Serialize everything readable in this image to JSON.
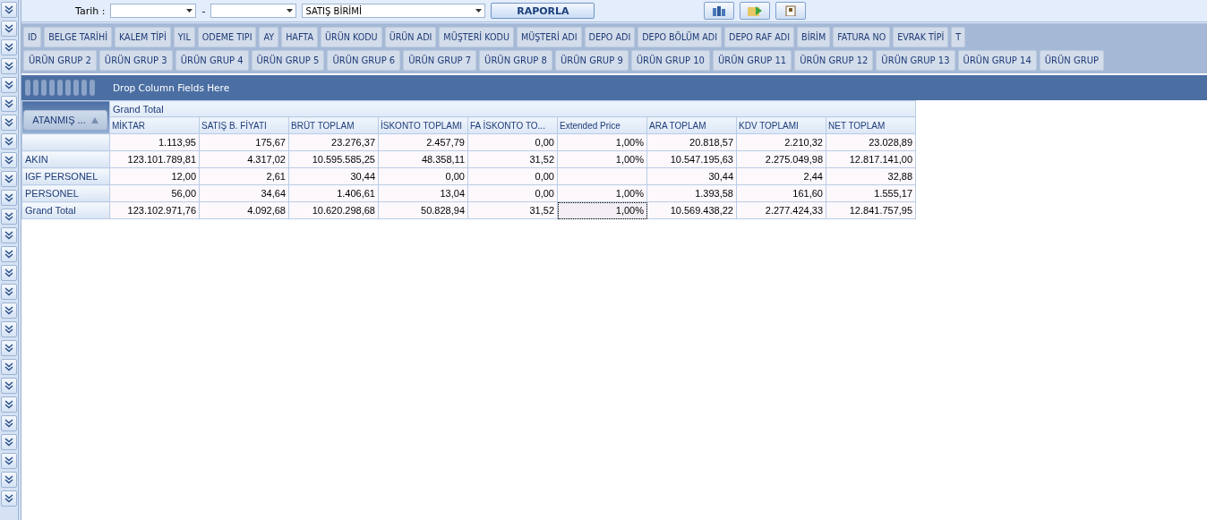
{
  "filter_bar": {
    "date_label": "Tarih :",
    "date_separator": "-",
    "unit_combo": "SATIŞ BİRİMİ",
    "report_button": "RAPORLA"
  },
  "field_list_rows": [
    [
      "ID",
      "BELGE TARİHİ",
      "KALEM TİPİ",
      "YIL",
      "ODEME TIPI",
      "AY",
      "HAFTA",
      "ÜRÜN KODU",
      "ÜRÜN ADI",
      "MÜŞTERİ KODU",
      "MÜŞTERİ ADI",
      "DEPO ADI",
      "DEPO BÖLÜM ADI",
      "DEPO RAF ADI",
      "BİRİM",
      "FATURA NO",
      "EVRAK TİPİ",
      "T"
    ],
    [
      "ÜRÜN GRUP 2",
      "ÜRÜN GRUP 3",
      "ÜRÜN GRUP 4",
      "ÜRÜN GRUP 5",
      "ÜRÜN GRUP 6",
      "ÜRÜN GRUP 7",
      "ÜRÜN GRUP 8",
      "ÜRÜN GRUP 9",
      "ÜRÜN GRUP 10",
      "ÜRÜN GRUP 11",
      "ÜRÜN GRUP 12",
      "ÜRÜN GRUP 13",
      "ÜRÜN GRUP 14",
      "ÜRÜN GRUP"
    ]
  ],
  "column_drop_area": "Drop Column Fields Here",
  "pivot": {
    "row_field": "ATANMIŞ ...",
    "column_total": "Grand Total",
    "columns": [
      "MİKTAR",
      "SATIŞ B. FİYATI",
      "BRÜT TOPLAM",
      "İSKONTO TOPLAMI",
      "FA İSKONTO TO...",
      "Extended Price",
      "ARA TOPLAM",
      "KDV TOPLAMI",
      "NET TOPLAM"
    ],
    "rows": [
      {
        "cells": [
          {
            "text": "1.113,95",
            "focused": false
          },
          {
            "text": "175,67",
            "focused": false
          },
          {
            "text": "23.276,37",
            "focused": false
          },
          {
            "text": "2.457,79",
            "focused": false
          },
          {
            "text": "0,00",
            "focused": false
          },
          {
            "text": "1,00%",
            "focused": false
          },
          {
            "text": "20.818,57",
            "focused": false
          },
          {
            "text": "2.210,32",
            "focused": false
          },
          {
            "text": "23.028,89",
            "focused": false
          }
        ]
      },
      {
        "label": "AKIN",
        "cells": [
          {
            "text": "123.101.789,81",
            "focused": false
          },
          {
            "text": "4.317,02",
            "focused": false
          },
          {
            "text": "10.595.585,25",
            "focused": false
          },
          {
            "text": "48.358,11",
            "focused": false
          },
          {
            "text": "31,52",
            "focused": false
          },
          {
            "text": "1,00%",
            "focused": false
          },
          {
            "text": "10.547.195,63",
            "focused": false
          },
          {
            "text": "2.275.049,98",
            "focused": false
          },
          {
            "text": "12.817.141,00",
            "focused": false
          }
        ]
      },
      {
        "label": "IGF PERSONEL",
        "cells": [
          {
            "text": "12,00",
            "focused": false
          },
          {
            "text": "2,61",
            "focused": false
          },
          {
            "text": "30,44",
            "focused": false
          },
          {
            "text": "0,00",
            "focused": false
          },
          {
            "text": "0,00",
            "focused": false
          },
          {
            "focused": false
          },
          {
            "text": "30,44",
            "focused": false
          },
          {
            "text": "2,44",
            "focused": false
          },
          {
            "text": "32,88",
            "focused": false
          }
        ]
      },
      {
        "label": "PERSONEL",
        "cells": [
          {
            "text": "56,00",
            "focused": false
          },
          {
            "text": "34,64",
            "focused": false
          },
          {
            "text": "1.406,61",
            "focused": false
          },
          {
            "text": "13,04",
            "focused": false
          },
          {
            "text": "0,00",
            "focused": false
          },
          {
            "text": "1,00%",
            "focused": false
          },
          {
            "text": "1.393,58",
            "focused": false
          },
          {
            "text": "161,60",
            "focused": false
          },
          {
            "text": "1.555,17",
            "focused": false
          }
        ]
      },
      {
        "label": "Grand Total",
        "cells": [
          {
            "text": "123.102.971,76",
            "focused": false
          },
          {
            "text": "4.092,68",
            "focused": false
          },
          {
            "text": "10.620.298,68",
            "focused": false
          },
          {
            "text": "50.828,94",
            "focused": false
          },
          {
            "text": "31,52",
            "focused": false
          },
          {
            "text": "1,00%",
            "focused": true
          },
          {
            "text": "10.569.438,22",
            "focused": false
          },
          {
            "text": "2.277.424,33",
            "focused": false
          },
          {
            "text": "12.841.757,95",
            "focused": false
          }
        ]
      }
    ]
  }
}
